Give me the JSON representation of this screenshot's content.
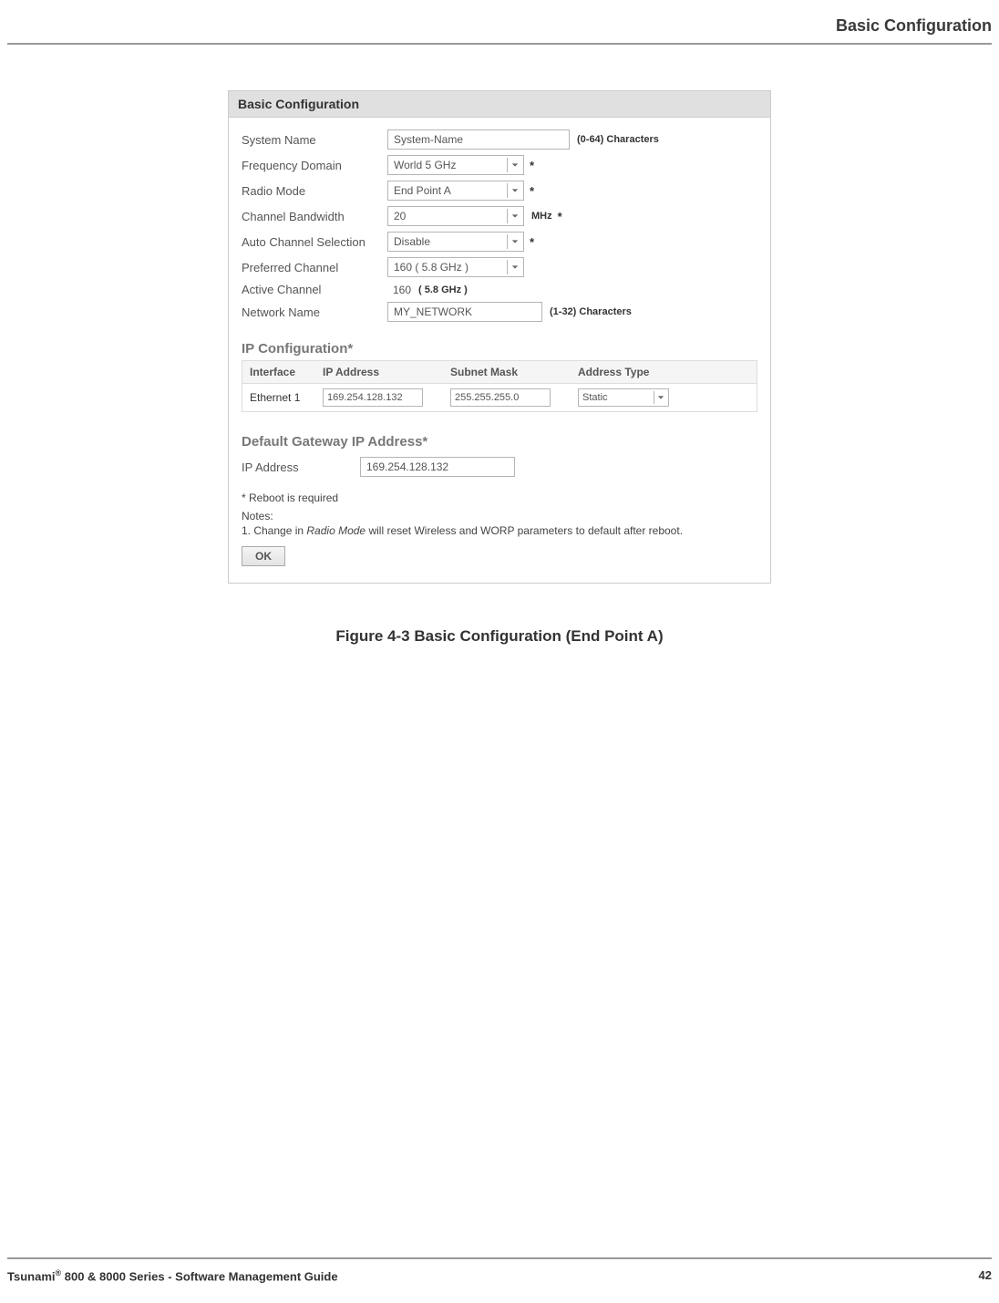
{
  "page": {
    "headerTitle": "Basic Configuration",
    "figureCaption": "Figure 4-3 Basic Configuration (End Point A)",
    "footerLeftPrefix": "Tsunami",
    "footerLeftSuffix": " 800 & 8000 Series - Software Management Guide",
    "footerRight": "42"
  },
  "panel": {
    "title": "Basic Configuration",
    "rows": {
      "systemName": {
        "label": "System Name",
        "value": "System-Name",
        "suffix": "(0-64) Characters"
      },
      "freqDomain": {
        "label": "Frequency Domain",
        "value": "World 5 GHz"
      },
      "radioMode": {
        "label": "Radio Mode",
        "value": "End Point A"
      },
      "channelBw": {
        "label": "Channel Bandwidth",
        "value": "20",
        "unit": "MHz"
      },
      "autoChan": {
        "label": "Auto Channel Selection",
        "value": "Disable"
      },
      "prefChan": {
        "label": "Preferred Channel",
        "value": "160 ( 5.8 GHz )"
      },
      "activeChan": {
        "label": "Active Channel",
        "value": "160",
        "paren": "( 5.8 GHz )"
      },
      "netName": {
        "label": "Network Name",
        "value": "MY_NETWORK",
        "suffix": "(1-32) Characters"
      }
    },
    "ipConfig": {
      "title": "IP Configuration*",
      "headers": {
        "if": "Interface",
        "ip": "IP Address",
        "sm": "Subnet Mask",
        "at": "Address Type"
      },
      "row": {
        "if": "Ethernet 1",
        "ip": "169.254.128.132",
        "sm": "255.255.255.0",
        "at": "Static"
      }
    },
    "gateway": {
      "title": "Default Gateway IP Address*",
      "label": "IP Address",
      "value": "169.254.128.132"
    },
    "notes": {
      "reboot": "* Reboot is required",
      "title": "Notes:",
      "line1_prefix": "1.  Change in ",
      "line1_italic": "Radio Mode",
      "line1_suffix": " will reset Wireless and WORP parameters to default after reboot."
    },
    "okLabel": "OK"
  }
}
